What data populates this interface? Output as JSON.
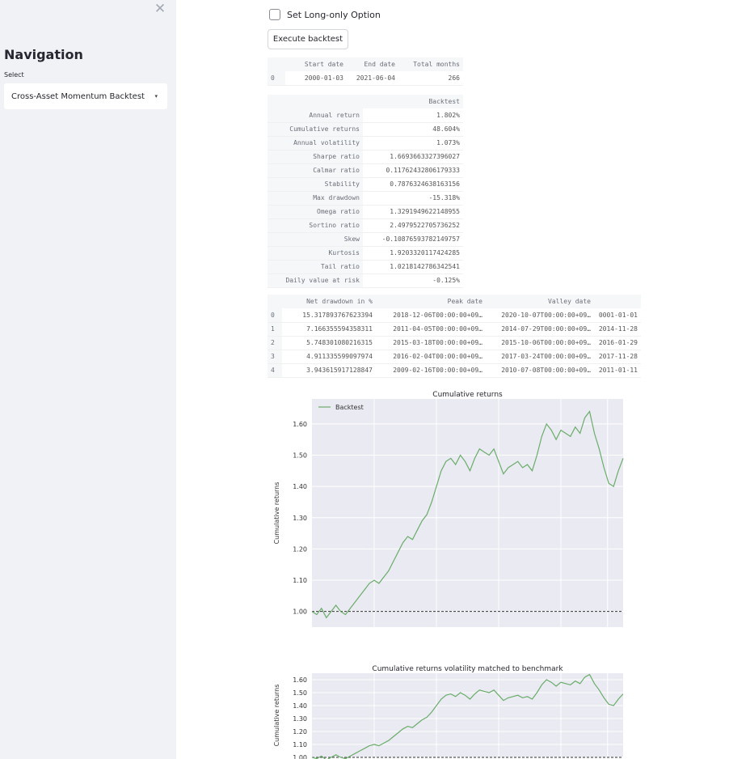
{
  "sidebar": {
    "close_glyph": "✕",
    "nav_title": "Navigation",
    "select_label": "Select",
    "select_value": "Cross-Asset Momentum Backtest",
    "select_caret": "▾"
  },
  "main": {
    "checkbox_label": "Set Long-only Option",
    "execute_button": "Execute backtest"
  },
  "table1": {
    "headers": [
      "",
      "Start date",
      "End date",
      "Total months"
    ],
    "rows": [
      [
        "0",
        "2000-01-03",
        "2021-06-04",
        "266"
      ]
    ]
  },
  "table2": {
    "header": "Backtest",
    "rows": [
      [
        "Annual return",
        "1.802%"
      ],
      [
        "Cumulative returns",
        "48.604%"
      ],
      [
        "Annual volatility",
        "1.073%"
      ],
      [
        "Sharpe ratio",
        "1.6693663327396027"
      ],
      [
        "Calmar ratio",
        "0.11762432806179333"
      ],
      [
        "Stability",
        "0.7876324638163156"
      ],
      [
        "Max drawdown",
        "-15.318%"
      ],
      [
        "Omega ratio",
        "1.3291949622148955"
      ],
      [
        "Sortino ratio",
        "2.4979522705736252"
      ],
      [
        "Skew",
        "-0.10876593782149757"
      ],
      [
        "Kurtosis",
        "1.9203320117424285"
      ],
      [
        "Tail ratio",
        "1.0218142786342541"
      ],
      [
        "Daily value at risk",
        "-0.125%"
      ]
    ]
  },
  "table3": {
    "headers": [
      "",
      "Net drawdown in %",
      "Peak date",
      "Valley date",
      ""
    ],
    "rows": [
      [
        "0",
        "15.317893767623394",
        "2018-12-06T00:00:00+09…",
        "2020-10-07T00:00:00+09…",
        "0001-01-01"
      ],
      [
        "1",
        "7.166355594358311",
        "2011-04-05T00:00:00+09…",
        "2014-07-29T00:00:00+09…",
        "2014-11-28"
      ],
      [
        "2",
        "5.748301080216315",
        "2015-03-18T00:00:00+09…",
        "2015-10-06T00:00:00+09…",
        "2016-01-29"
      ],
      [
        "3",
        "4.911335599097974",
        "2016-02-04T00:00:00+09…",
        "2017-03-24T00:00:00+09…",
        "2017-11-28"
      ],
      [
        "4",
        "3.943615917128847",
        "2009-02-16T00:00:00+09…",
        "2010-07-08T00:00:00+09…",
        "2011-01-11"
      ]
    ]
  },
  "colors": {
    "line": "#6aac6a",
    "plot_bg": "#eaeaf2",
    "sidebar_bg": "#f0f2f6"
  },
  "chart_data": [
    {
      "type": "line",
      "title": "Cumulative returns",
      "ylabel": "Cumulative returns",
      "xlabel": "",
      "legend": "top-left",
      "grid": true,
      "y_ticks": [
        "1.00",
        "1.10",
        "1.20",
        "1.30",
        "1.40",
        "1.50",
        "1.60"
      ],
      "ylim": [
        0.95,
        1.68
      ],
      "baseline": 1.0,
      "series": [
        {
          "name": "Backtest",
          "values": [
            1.0,
            0.99,
            1.01,
            0.98,
            1.0,
            1.02,
            1.0,
            0.99,
            1.01,
            1.03,
            1.05,
            1.07,
            1.09,
            1.1,
            1.09,
            1.11,
            1.13,
            1.16,
            1.19,
            1.22,
            1.24,
            1.23,
            1.26,
            1.29,
            1.31,
            1.35,
            1.4,
            1.45,
            1.48,
            1.49,
            1.47,
            1.5,
            1.48,
            1.45,
            1.49,
            1.52,
            1.51,
            1.5,
            1.52,
            1.48,
            1.44,
            1.46,
            1.47,
            1.48,
            1.46,
            1.47,
            1.45,
            1.5,
            1.56,
            1.6,
            1.58,
            1.55,
            1.58,
            1.57,
            1.56,
            1.59,
            1.57,
            1.62,
            1.64,
            1.57,
            1.52,
            1.46,
            1.41,
            1.4,
            1.45,
            1.49
          ]
        }
      ]
    },
    {
      "type": "line",
      "title": "Cumulative returns volatility matched to benchmark",
      "ylabel": "Cumulative returns",
      "xlabel": "",
      "grid": true,
      "y_ticks": [
        "1.00",
        "1.10",
        "1.20",
        "1.30",
        "1.40",
        "1.50",
        "1.60"
      ],
      "ylim": [
        1.0,
        1.65
      ],
      "baseline": 1.0,
      "series": [
        {
          "name": "",
          "values": [
            1.0,
            0.99,
            1.01,
            0.98,
            1.0,
            1.02,
            1.0,
            0.99,
            1.01,
            1.03,
            1.05,
            1.07,
            1.09,
            1.1,
            1.09,
            1.11,
            1.13,
            1.16,
            1.19,
            1.22,
            1.24,
            1.23,
            1.26,
            1.29,
            1.31,
            1.35,
            1.4,
            1.45,
            1.48,
            1.49,
            1.47,
            1.5,
            1.48,
            1.45,
            1.49,
            1.52,
            1.51,
            1.5,
            1.52,
            1.48,
            1.44,
            1.46,
            1.47,
            1.48,
            1.46,
            1.47,
            1.45,
            1.5,
            1.56,
            1.6,
            1.58,
            1.55,
            1.58,
            1.57,
            1.56,
            1.59,
            1.57,
            1.62,
            1.64,
            1.57,
            1.52,
            1.46,
            1.41,
            1.4,
            1.45,
            1.49
          ]
        }
      ]
    }
  ]
}
